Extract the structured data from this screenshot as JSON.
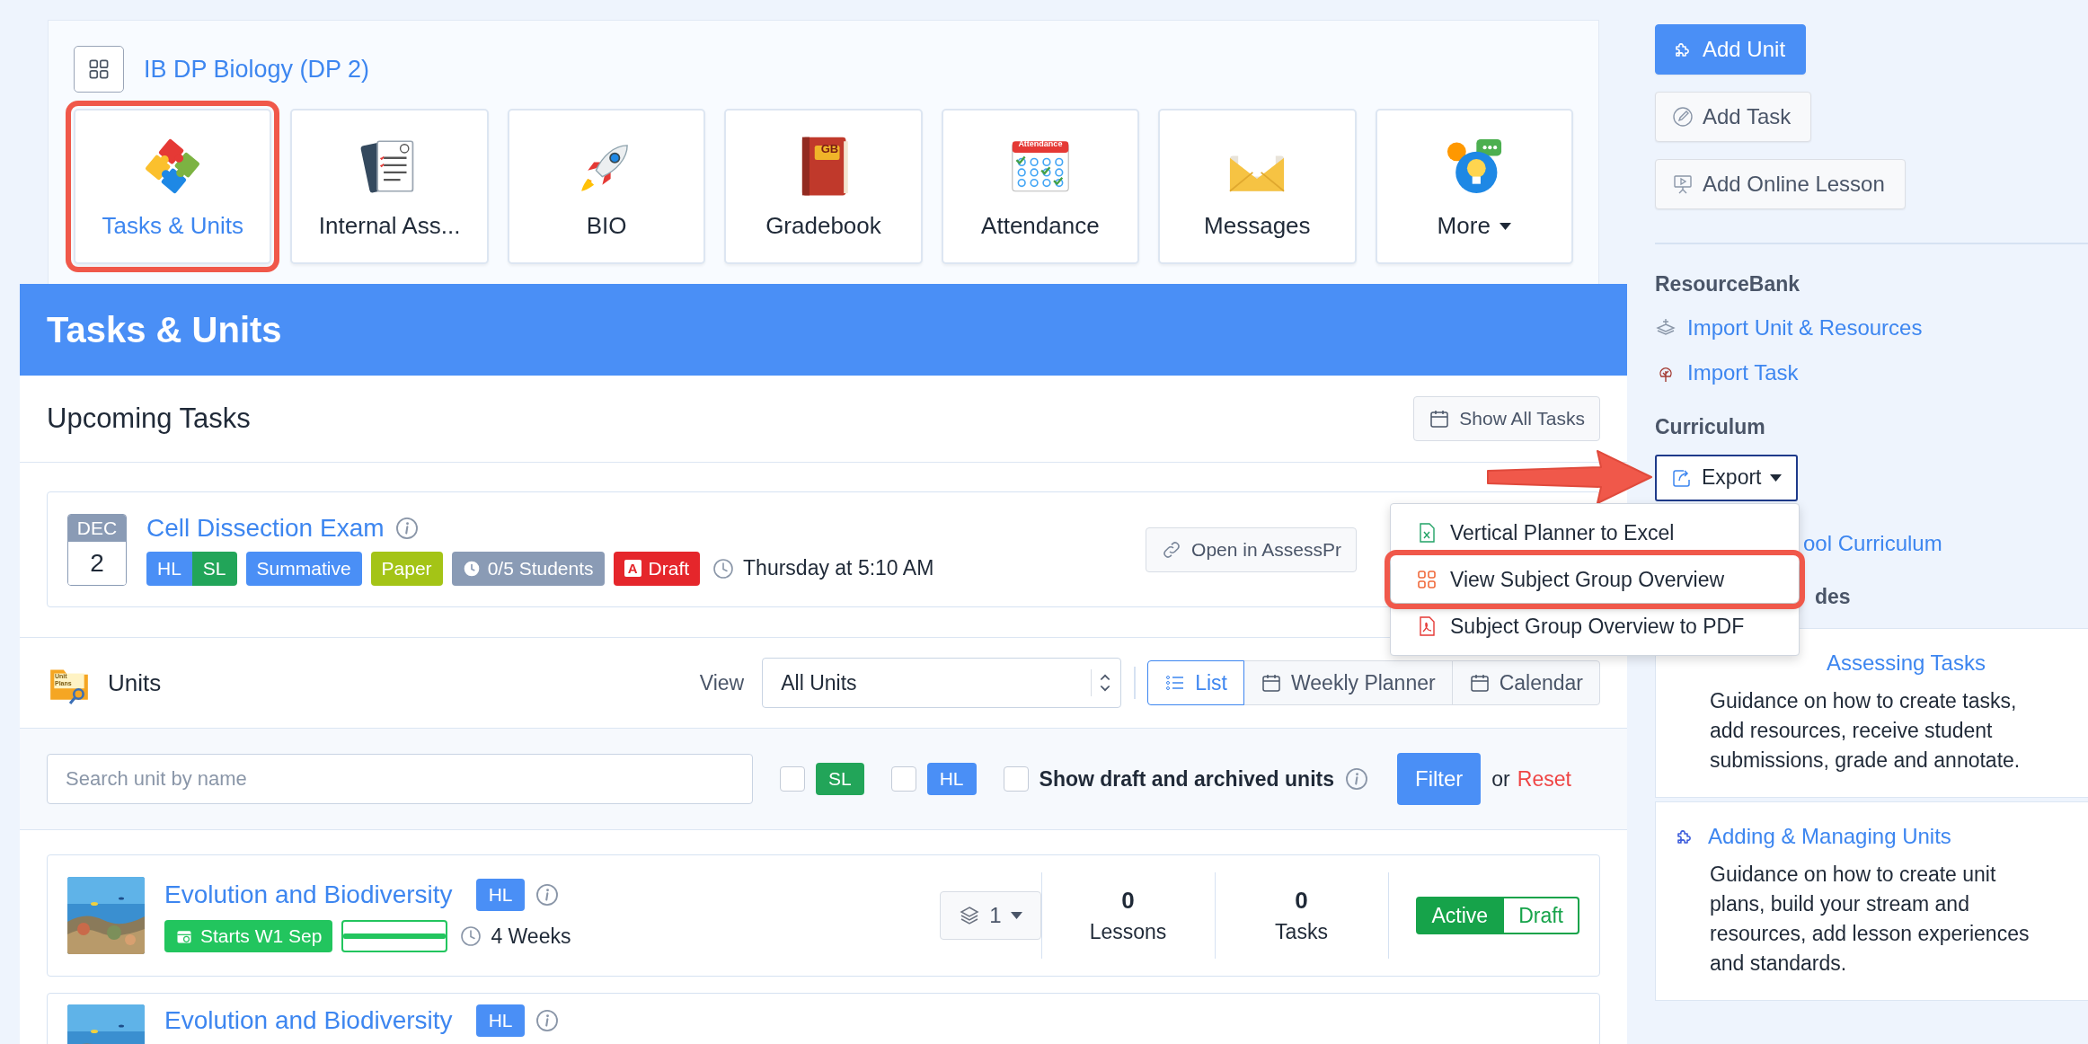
{
  "course": {
    "title": "IB DP Biology (DP 2)"
  },
  "app_tiles": [
    {
      "label": "Tasks & Units",
      "kind": "puzzle",
      "selected": true,
      "highlighted": true
    },
    {
      "label": "Internal Ass...",
      "kind": "notebook",
      "selected": false,
      "highlighted": false
    },
    {
      "label": "BIO",
      "kind": "rocket",
      "selected": false,
      "highlighted": false
    },
    {
      "label": "Gradebook",
      "kind": "book",
      "icon_label": "GB",
      "selected": false,
      "highlighted": false
    },
    {
      "label": "Attendance",
      "kind": "attendance",
      "icon_label": "Attendance",
      "selected": false,
      "highlighted": false
    },
    {
      "label": "Messages",
      "kind": "envelope",
      "selected": false,
      "highlighted": false
    },
    {
      "label": "More",
      "kind": "more",
      "selected": false,
      "highlighted": false
    }
  ],
  "section_header": {
    "title": "Tasks & Units"
  },
  "upcoming": {
    "title": "Upcoming Tasks",
    "show_all_button": "Show All Tasks",
    "tasks": [
      {
        "month": "DEC",
        "day": "2",
        "title": "Cell Dissection Exam",
        "levels": [
          {
            "label": "HL",
            "color": "#4a8ff6"
          },
          {
            "label": "SL",
            "color": "#22a559"
          }
        ],
        "badges": [
          {
            "kind": "plain",
            "label": "Summative",
            "color": "#4a8ff6"
          },
          {
            "kind": "plain",
            "label": "Paper",
            "color": "#a4c416"
          },
          {
            "kind": "clock",
            "label": "0/5 Students",
            "color": "#8a9bb5"
          },
          {
            "kind": "lettered",
            "letter": "A",
            "label": "Draft",
            "color": "#e5262b"
          }
        ],
        "due": "Thursday at 5:10 AM",
        "open_button": "Open in AssessPr"
      }
    ]
  },
  "units": {
    "title": "Units",
    "icon_label": "Unit Plans",
    "view_label": "View",
    "view_select": "All Units",
    "view_modes": [
      {
        "label": "List",
        "kind": "list",
        "selected": true
      },
      {
        "label": "Weekly Planner",
        "kind": "planner",
        "selected": false
      },
      {
        "label": "Calendar",
        "kind": "calendar",
        "selected": false
      }
    ],
    "search": {
      "placeholder": "Search unit by name"
    },
    "filters": [
      {
        "kind": "badge",
        "label": "SL",
        "color": "#22a559",
        "checked": false
      },
      {
        "kind": "badge",
        "label": "HL",
        "color": "#4a8ff6",
        "checked": false
      },
      {
        "kind": "text",
        "label": "Show draft and archived units",
        "checked": false
      }
    ],
    "filter_button": "Filter",
    "or_text": "or",
    "reset_link": "Reset",
    "rows": [
      {
        "title": "Evolution and Biodiversity",
        "level_badge": "HL",
        "start": "Starts W1 Sep",
        "progress": {
          "level": 1
        },
        "duration": "4 Weeks",
        "streams": "1",
        "lessons": "0",
        "lessons_label": "Lessons",
        "tasks": "0",
        "tasks_label": "Tasks",
        "statuses": [
          {
            "label": "Active",
            "selected": true
          },
          {
            "label": "Draft",
            "selected": false
          }
        ]
      },
      {
        "title": "Evolution and Biodiversity",
        "level_badge": "HL"
      }
    ]
  },
  "sidebar": {
    "actions": [
      {
        "label": "Add Unit",
        "kind": "unit",
        "primary": true
      },
      {
        "label": "Add Task",
        "kind": "task",
        "primary": false
      },
      {
        "label": "Add Online Lesson",
        "kind": "lesson",
        "primary": false
      }
    ],
    "resource_bank": {
      "title": "ResourceBank",
      "links": [
        {
          "label": "Import Unit & Resources",
          "kind": "layers"
        },
        {
          "label": "Import Task",
          "kind": "tree"
        }
      ]
    },
    "curriculum": {
      "title": "Curriculum",
      "export_button": "Export",
      "export_menu": [
        {
          "label": "Vertical Planner to Excel",
          "kind": "excel",
          "highlighted": false
        },
        {
          "label": "View Subject Group Overview",
          "kind": "grid",
          "highlighted": true
        },
        {
          "label": "Subject Group Overview to PDF",
          "kind": "pdf",
          "highlighted": false
        }
      ],
      "link": "ool Curriculum"
    },
    "guides": {
      "title": "des",
      "cards": [
        {
          "kind": "covered",
          "title": "Assessing Tasks",
          "text": "Guidance on how to create tasks, add resources, receive student submissions, grade and annotate."
        },
        {
          "kind": "puzzle",
          "title": "Adding & Managing Units",
          "text": "Guidance on how to create unit plans, build your stream and resources, add lesson experiences and standards."
        }
      ]
    }
  }
}
